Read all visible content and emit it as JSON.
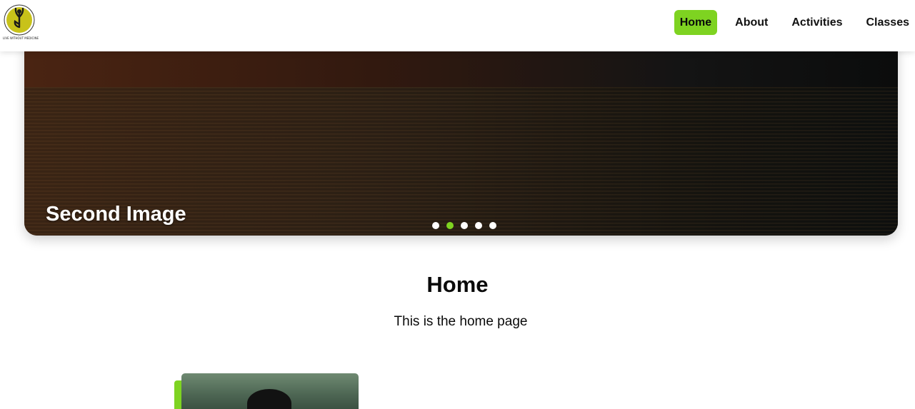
{
  "brand": {
    "logo_icon": "yoga-pose-logo-icon",
    "logo_text": "LIVE WITHOUT MEDICINE",
    "accent_color": "#7ed321"
  },
  "nav": {
    "items": [
      {
        "label": "Home",
        "active": true
      },
      {
        "label": "About",
        "active": false
      },
      {
        "label": "Activities",
        "active": false
      },
      {
        "label": "Classes",
        "active": false
      }
    ]
  },
  "hero": {
    "caption": "Second Image",
    "slide_count": 5,
    "active_slide": 2
  },
  "main": {
    "title": "Home",
    "subtitle": "This is the home page"
  }
}
